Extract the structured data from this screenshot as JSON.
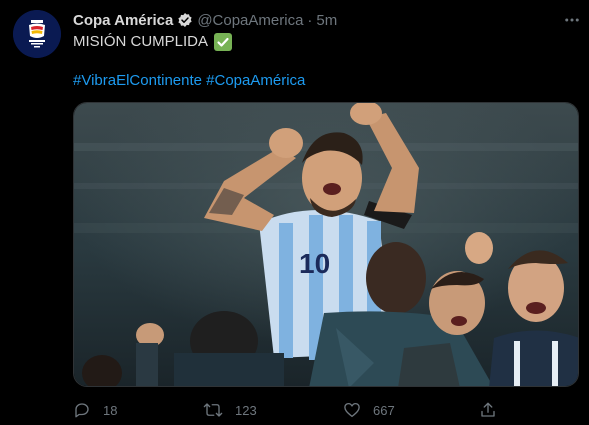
{
  "tweet": {
    "author_name": "Copa América",
    "handle": "@CopaAmerica",
    "separator": "·",
    "timestamp": "5m",
    "text": "MISIÓN CUMPLIDA",
    "text_emoji": "white-heavy-check-mark",
    "hashtags": [
      "#VibraElContinente",
      "#CopaAmérica"
    ],
    "media": {
      "type": "photo"
    },
    "actions": {
      "reply_count": "18",
      "retweet_count": "123",
      "like_count": "667"
    }
  },
  "colors": {
    "background": "#000000",
    "text": "#d9d9d9",
    "secondary": "#6e767d",
    "link": "#1d9bf0",
    "check_green": "#77b255",
    "avatar_bg": "#0a1a52"
  },
  "icons": {
    "more": "more-icon",
    "verified": "verified-badge-icon",
    "reply": "reply-icon",
    "retweet": "retweet-icon",
    "like": "like-icon",
    "share": "share-icon"
  }
}
